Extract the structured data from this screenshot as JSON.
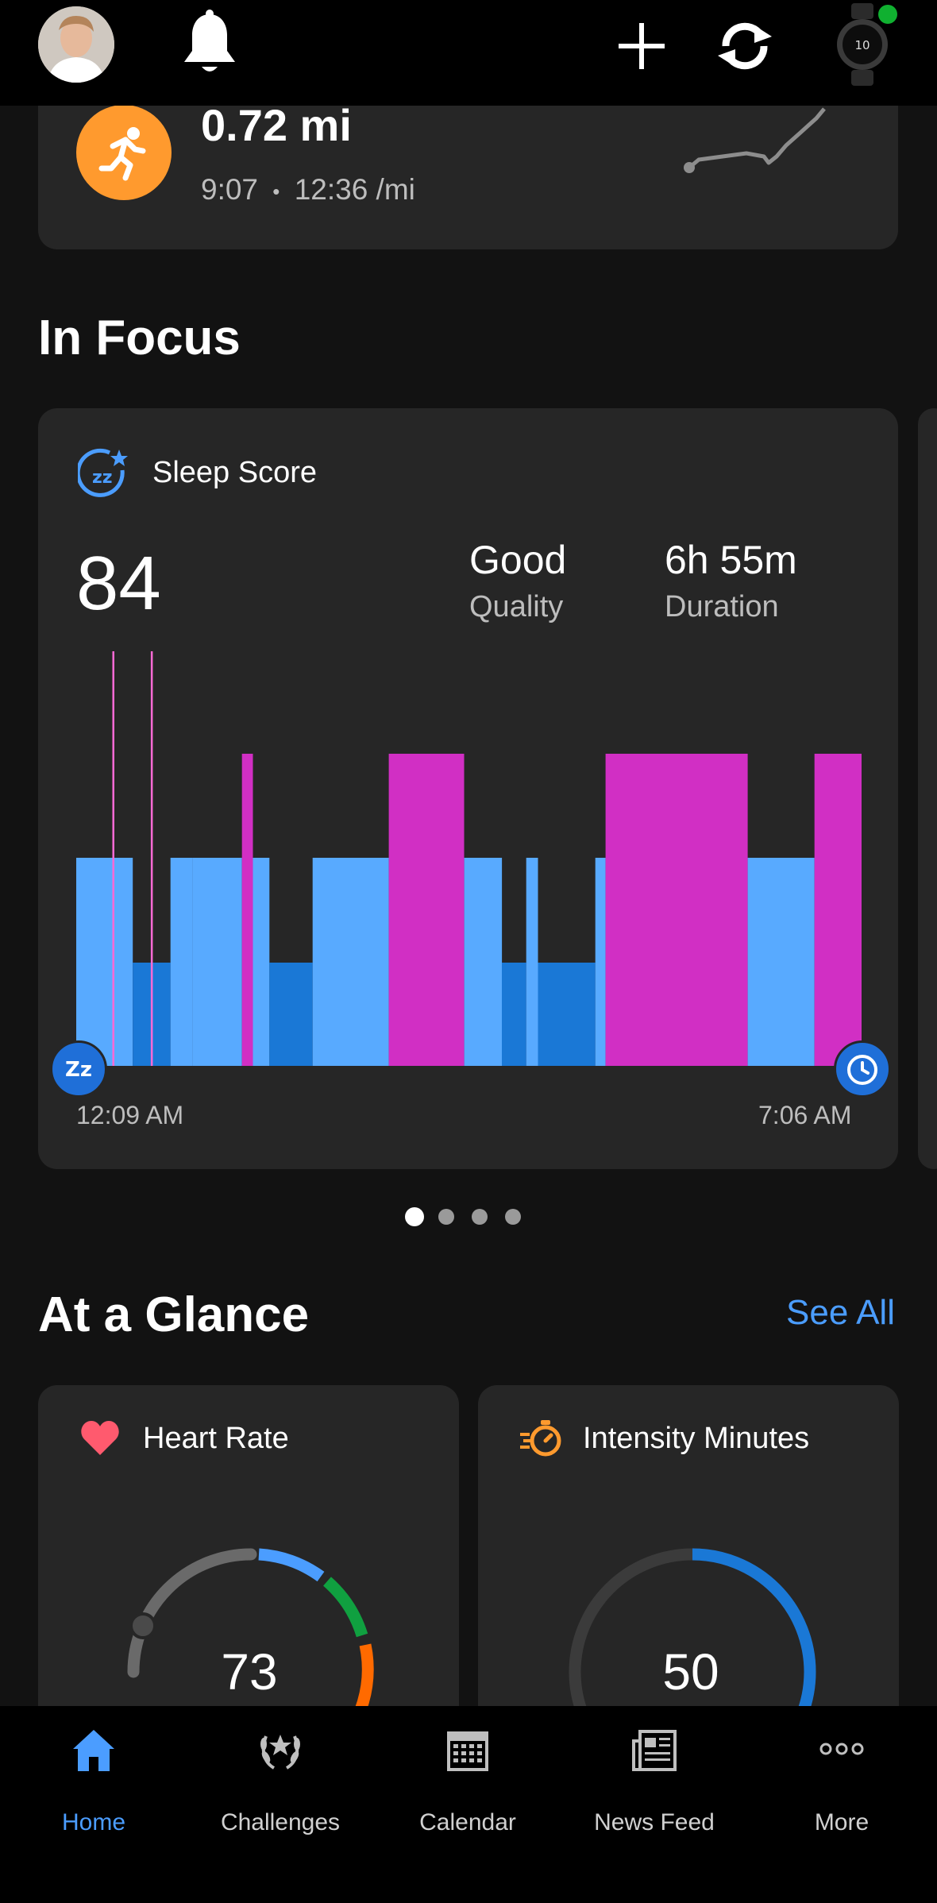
{
  "colors": {
    "accent": "#4b9dff",
    "run": "#ff9a2e",
    "deep": "#1a78d6",
    "light": "#58aaff",
    "rem": "#d12fc4",
    "awake": "#ff6ad5",
    "heart": "#ff5a6e",
    "intensity": "#ff9a2e"
  },
  "topbar": {
    "avatar_icon": "user-avatar",
    "bell_icon": "bell-icon",
    "add_icon": "plus-icon",
    "sync_icon": "sync-icon",
    "device_icon": "watch-icon",
    "device_connected": true
  },
  "activity": {
    "distance": "0.72 mi",
    "duration": "9:07",
    "separator": "•",
    "pace": "12:36 /mi"
  },
  "in_focus": {
    "title": "In Focus",
    "sleep": {
      "title": "Sleep Score",
      "score": "84",
      "quality_value": "Good",
      "quality_label": "Quality",
      "duration_value": "6h 55m",
      "duration_label": "Duration",
      "start_time": "12:09 AM",
      "end_time": "7:06 AM"
    },
    "pager": {
      "count": 4,
      "active": 0
    }
  },
  "chart_data": {
    "type": "bar",
    "title": "Sleep Score",
    "x_start": "12:09 AM",
    "x_end": "7:06 AM",
    "stages": [
      "deep",
      "light",
      "rem",
      "awake"
    ],
    "segments": [
      {
        "stage": "light",
        "start": 0.0,
        "end": 0.072
      },
      {
        "stage": "deep",
        "start": 0.072,
        "end": 0.12
      },
      {
        "stage": "light",
        "start": 0.12,
        "end": 0.148
      },
      {
        "stage": "light",
        "start": 0.148,
        "end": 0.211
      },
      {
        "stage": "rem",
        "start": 0.211,
        "end": 0.225
      },
      {
        "stage": "light",
        "start": 0.225,
        "end": 0.246
      },
      {
        "stage": "deep",
        "start": 0.246,
        "end": 0.301
      },
      {
        "stage": "light",
        "start": 0.301,
        "end": 0.398
      },
      {
        "stage": "rem",
        "start": 0.398,
        "end": 0.494
      },
      {
        "stage": "light",
        "start": 0.494,
        "end": 0.542
      },
      {
        "stage": "deep",
        "start": 0.542,
        "end": 0.573
      },
      {
        "stage": "light",
        "start": 0.573,
        "end": 0.588
      },
      {
        "stage": "deep",
        "start": 0.588,
        "end": 0.661
      },
      {
        "stage": "light",
        "start": 0.661,
        "end": 0.674
      },
      {
        "stage": "rem",
        "start": 0.674,
        "end": 0.855
      },
      {
        "stage": "light",
        "start": 0.855,
        "end": 0.94
      },
      {
        "stage": "rem",
        "start": 0.94,
        "end": 1.0
      }
    ],
    "awake_marks": [
      0.047,
      0.096
    ]
  },
  "at_a_glance": {
    "title": "At a Glance",
    "see_all": "See All",
    "heart_rate": {
      "title": "Heart Rate",
      "value": "73",
      "icon": "heart-icon"
    },
    "intensity": {
      "title": "Intensity Minutes",
      "value": "50",
      "icon": "stopwatch-icon",
      "progress": 0.33
    }
  },
  "nav": {
    "active": "home",
    "items": [
      {
        "id": "home",
        "label": "Home",
        "icon": "home-icon"
      },
      {
        "id": "challenges",
        "label": "Challenges",
        "icon": "laurel-icon"
      },
      {
        "id": "calendar",
        "label": "Calendar",
        "icon": "calendar-icon"
      },
      {
        "id": "news",
        "label": "News Feed",
        "icon": "newspaper-icon"
      },
      {
        "id": "more",
        "label": "More",
        "icon": "more-icon"
      }
    ]
  }
}
